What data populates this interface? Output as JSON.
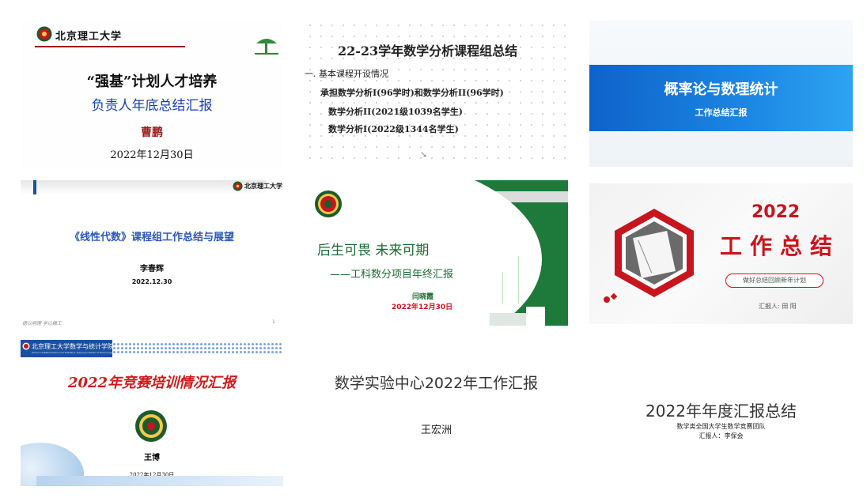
{
  "slides": [
    {
      "id": "s1",
      "school": "北京理工大学",
      "title1": "“强基”计划人才培养",
      "title2": "负责人年底总结汇报",
      "presenter": "曹鹏",
      "date": "2022年12月30日"
    },
    {
      "id": "s2",
      "title": "22-23学年数学分析课程组总结",
      "section": "一. 基本课程开设情况",
      "line1": "承担数学分析I(96学时)和数学分析II(96学时)",
      "line2": "数学分析II(2021级1039名学生)",
      "line3": "数学分析I(2022级1344名学生)"
    },
    {
      "id": "s3",
      "title": "概率论与数理统计",
      "subtitle": "工作总结汇报"
    },
    {
      "id": "s4",
      "school": "北京理工大学",
      "title": "《线性代数》课程组工作总结与展望",
      "presenter": "李春辉",
      "date": "2022.12.30",
      "footer_left": "德以明理 学以精工",
      "page": "1"
    },
    {
      "id": "s5",
      "title": "后生可畏  未来可期",
      "subtitle": "——工科数分项目年终汇报",
      "presenter": "闫晓霞",
      "date": "2022年12月30日"
    },
    {
      "id": "s6",
      "year": "2022",
      "title": "工作总结",
      "subtitle": "做好总结回顾新年计划",
      "reporter": "汇报人: 田 阳"
    },
    {
      "id": "s7",
      "school_header": "北京理工大学数学与统计学院",
      "school_header_en": "School of Mathematics and Statistics, Beijing Institute of Technology",
      "title": "2022年竞赛培训情况汇报",
      "presenter": "王博",
      "date": "2022年12月30日"
    },
    {
      "id": "s8",
      "title": "数学实验中心2022年工作汇报",
      "presenter": "王宏洲"
    },
    {
      "id": "s9",
      "title": "2022年年度汇报总结",
      "team": "数学类全国大学生数学竞赛团队",
      "reporter": "汇报人：李保会"
    }
  ],
  "colors": {
    "bit_red": "#c8151d",
    "bit_green": "#1d7a3a",
    "blue_band": "#1b7fe0"
  }
}
